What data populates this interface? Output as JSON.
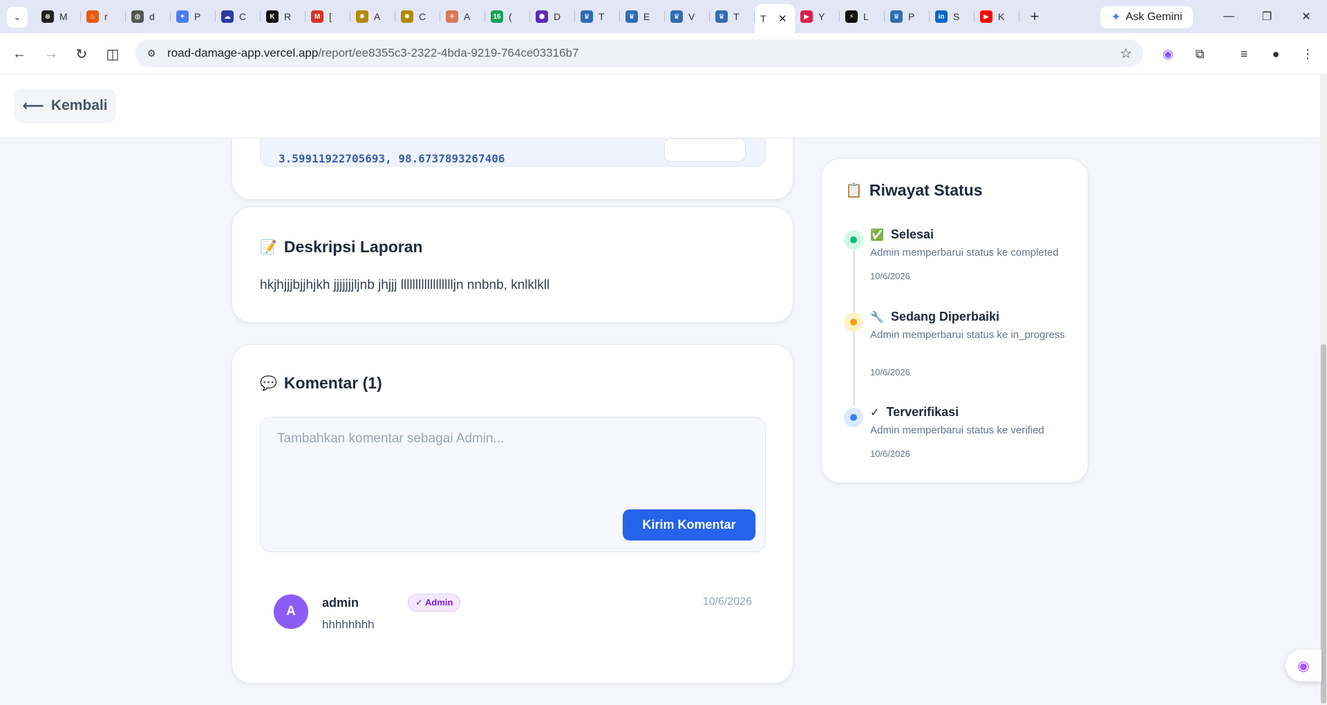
{
  "browser": {
    "tabs": [
      {
        "icon": "chatgpt-icon",
        "label": "M",
        "color": "#222222"
      },
      {
        "icon": "fire-icon",
        "label": "r",
        "color": "#e8590c"
      },
      {
        "icon": "globe-icon",
        "label": "d",
        "color": "#555555"
      },
      {
        "icon": "gemini-icon",
        "label": "P",
        "color": "#4a7cf6"
      },
      {
        "icon": "cloud-icon",
        "label": "C",
        "color": "#2b3a9e"
      },
      {
        "icon": "k-icon",
        "label": "R",
        "color": "#111111"
      },
      {
        "icon": "gmail-icon",
        "label": "[",
        "color": "#d93025"
      },
      {
        "icon": "network-icon",
        "label": "A",
        "color": "#b08900"
      },
      {
        "icon": "network-icon",
        "label": "C",
        "color": "#b08900"
      },
      {
        "icon": "claude-icon",
        "label": "A",
        "color": "#d97757"
      },
      {
        "icon": "sixteen-icon",
        "label": "(",
        "color": "#18a058"
      },
      {
        "icon": "hexagon-icon",
        "label": "D",
        "color": "#5b2bb5"
      },
      {
        "icon": "university-icon",
        "label": "T",
        "color": "#2f6db5"
      },
      {
        "icon": "university-icon",
        "label": "E",
        "color": "#2f6db5"
      },
      {
        "icon": "university-icon",
        "label": "V",
        "color": "#2f6db5"
      },
      {
        "icon": "university-icon",
        "label": "T",
        "color": "#2f6db5"
      }
    ],
    "active_tab": {
      "label": "T",
      "close": "✕"
    },
    "tabs_after": [
      {
        "icon": "play-circle-icon",
        "label": "Y",
        "color": "#e11d48"
      },
      {
        "icon": "pulse-icon",
        "label": "L",
        "color": "#111111"
      },
      {
        "icon": "university-icon",
        "label": "P",
        "color": "#2f6db5"
      },
      {
        "icon": "linkedin-icon",
        "label": "S",
        "color": "#0a66c2"
      },
      {
        "icon": "youtube-icon",
        "label": "K",
        "color": "#ff0000"
      }
    ],
    "new_tab": "+",
    "ask_gemini": "Ask Gemini",
    "url_host": "road-damage-app.vercel.app",
    "url_path": "/report/ee8355c3-2322-4bda-9219-764ce03316b7"
  },
  "nav": {
    "back_label": "Kembali"
  },
  "location": {
    "coordinates": "3.59911922705693, 98.6737893267406"
  },
  "description": {
    "title": "Deskripsi Laporan",
    "text": "hkjhjjjbjjhjkh jjjjjjjljnb jhjjj lllllllllllllllllljn nnbnb, knlklkll"
  },
  "comments": {
    "title": "Komentar (1)",
    "placeholder": "Tambahkan komentar sebagai Admin...",
    "send_label": "Kirim Komentar",
    "items": [
      {
        "avatar_letter": "A",
        "author": "admin",
        "badge": "✓ Admin",
        "date": "10/6/2026",
        "text": "hhhhhhhh"
      }
    ]
  },
  "status_history": {
    "title": "Riwayat Status",
    "items": [
      {
        "label": "Selesai",
        "desc": "Admin memperbarui status ke completed",
        "date": "10/6/2026",
        "color": "#10b981"
      },
      {
        "label": "Sedang Diperbaiki",
        "desc": "Admin memperbarui status ke in_progress",
        "date": "10/6/2026",
        "color": "#f59e0b"
      },
      {
        "label": "Terverifikasi",
        "desc": "Admin memperbarui status ke verified",
        "date": "10/6/2026",
        "color": "#3b82f6"
      }
    ]
  },
  "colors": {
    "primary": "#2563eb",
    "avatar": "#8b5cf6",
    "admin_badge": "#7e22ce"
  }
}
